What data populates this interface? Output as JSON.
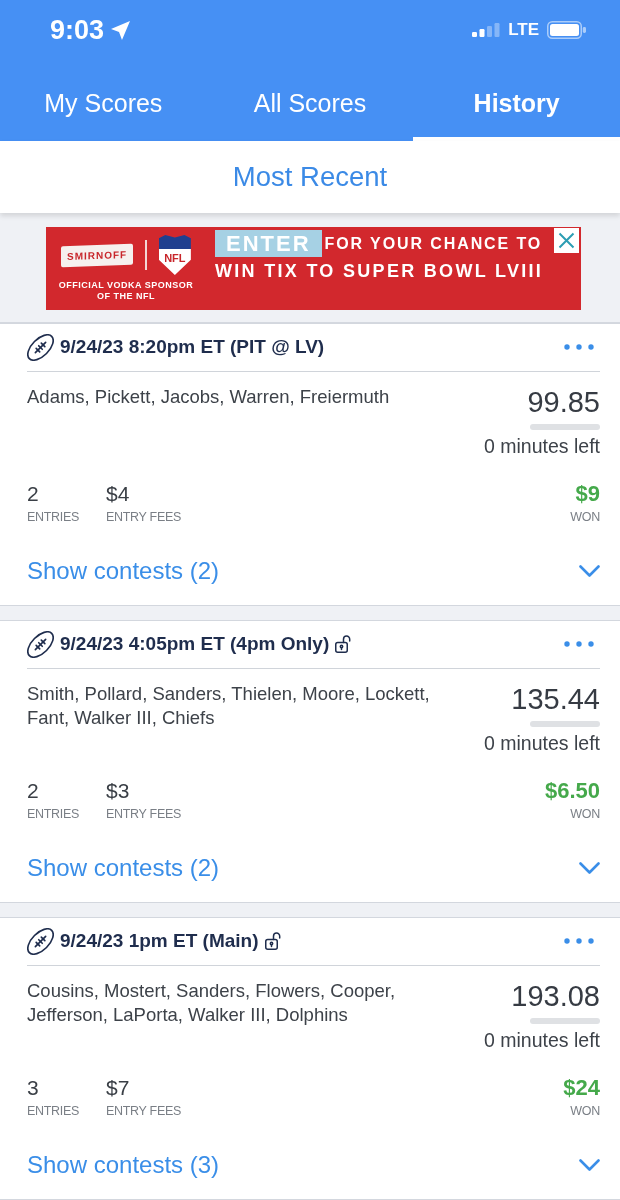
{
  "status_bar": {
    "time": "9:03",
    "network": "LTE"
  },
  "tabs": [
    {
      "label": "My Scores",
      "selected": false
    },
    {
      "label": "All Scores",
      "selected": false
    },
    {
      "label": "History",
      "selected": true
    }
  ],
  "sort": {
    "label": "Most Recent"
  },
  "ad": {
    "brand": "SMIRNOFF",
    "shield_text": "NFL",
    "sponsor_line": "OFFICIAL VODKA SPONSOR OF THE NFL",
    "cta": "ENTER",
    "headline": "FOR YOUR CHANCE TO",
    "headline_2": "WIN TIX TO SUPER BOWL LVIII"
  },
  "contests": [
    {
      "title": "9/24/23 8:20pm ET (PIT @ LV)",
      "padlock": false,
      "players": "Adams, Pickett, Jacobs, Warren, Freiermuth",
      "score": "99.85",
      "level": 0,
      "time_left": "0 minutes left",
      "entries": "2",
      "entries_label": "ENTRIES",
      "fees": "$4",
      "fees_label": "ENTRY FEES",
      "won": "$9",
      "won_label": "WON",
      "show_contests": "Show contests (2)",
      "expanded": false
    },
    {
      "title": "9/24/23 4:05pm ET (4pm Only)",
      "padlock": true,
      "players": "Smith, Pollard, Sanders, Thielen, Moore, Lockett, Fant, Walker III, Chiefs",
      "score": "135.44",
      "level": 0,
      "time_left": "0 minutes left",
      "entries": "2",
      "entries_label": "ENTRIES",
      "fees": "$3",
      "fees_label": "ENTRY FEES",
      "won": "$6.50",
      "won_label": "WON",
      "show_contests": "Show contests (2)",
      "expanded": false
    },
    {
      "title": "9/24/23 1pm ET (Main)",
      "padlock": true,
      "players": "Cousins, Mostert, Sanders, Flowers, Cooper, Jefferson, LaPorta, Walker III, Dolphins",
      "score": "193.08",
      "level": 0,
      "time_left": "0 minutes left",
      "entries": "3",
      "entries_label": "ENTRIES",
      "fees": "$7",
      "fees_label": "ENTRY FEES",
      "won": "$24",
      "won_label": "WON",
      "show_contests": "Show contests (3)",
      "expanded": false
    }
  ]
}
